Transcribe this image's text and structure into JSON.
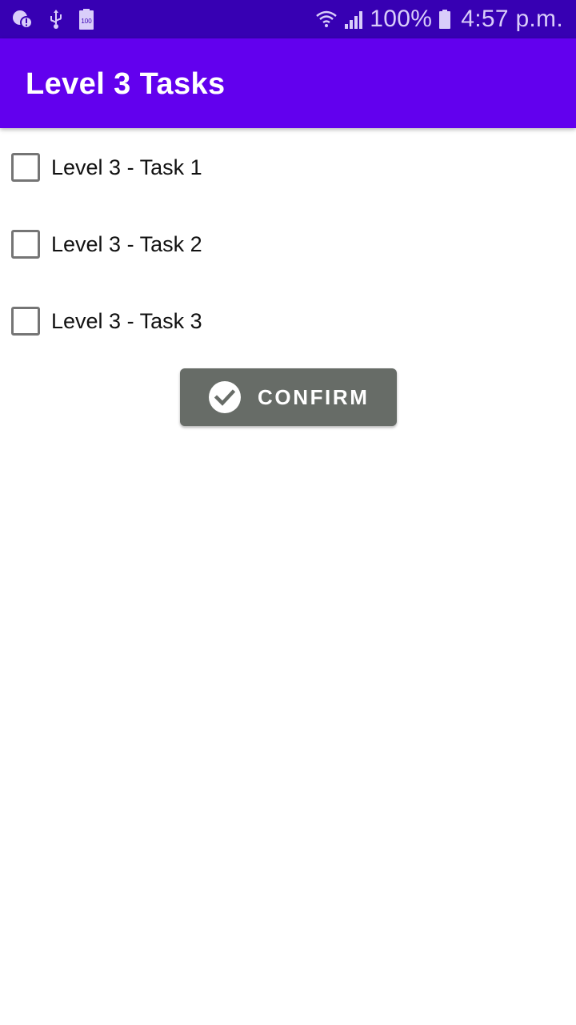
{
  "status_bar": {
    "battery_percent": "100%",
    "time": "4:57 p.m.",
    "icons": [
      "data-saver-alert-icon",
      "usb-icon",
      "battery-saver-icon",
      "wifi-icon",
      "cell-signal-icon",
      "battery-icon"
    ],
    "battery_saver_badge": "100"
  },
  "app_bar": {
    "title": "Level 3 Tasks",
    "color": "#6200ee"
  },
  "tasks": [
    {
      "label": "Level 3 - Task 1",
      "checked": false
    },
    {
      "label": "Level 3 - Task 2",
      "checked": false
    },
    {
      "label": "Level 3 - Task 3",
      "checked": false
    }
  ],
  "confirm_button": {
    "label": "CONFIRM",
    "icon": "check-circle-icon",
    "color": "#676c67"
  }
}
